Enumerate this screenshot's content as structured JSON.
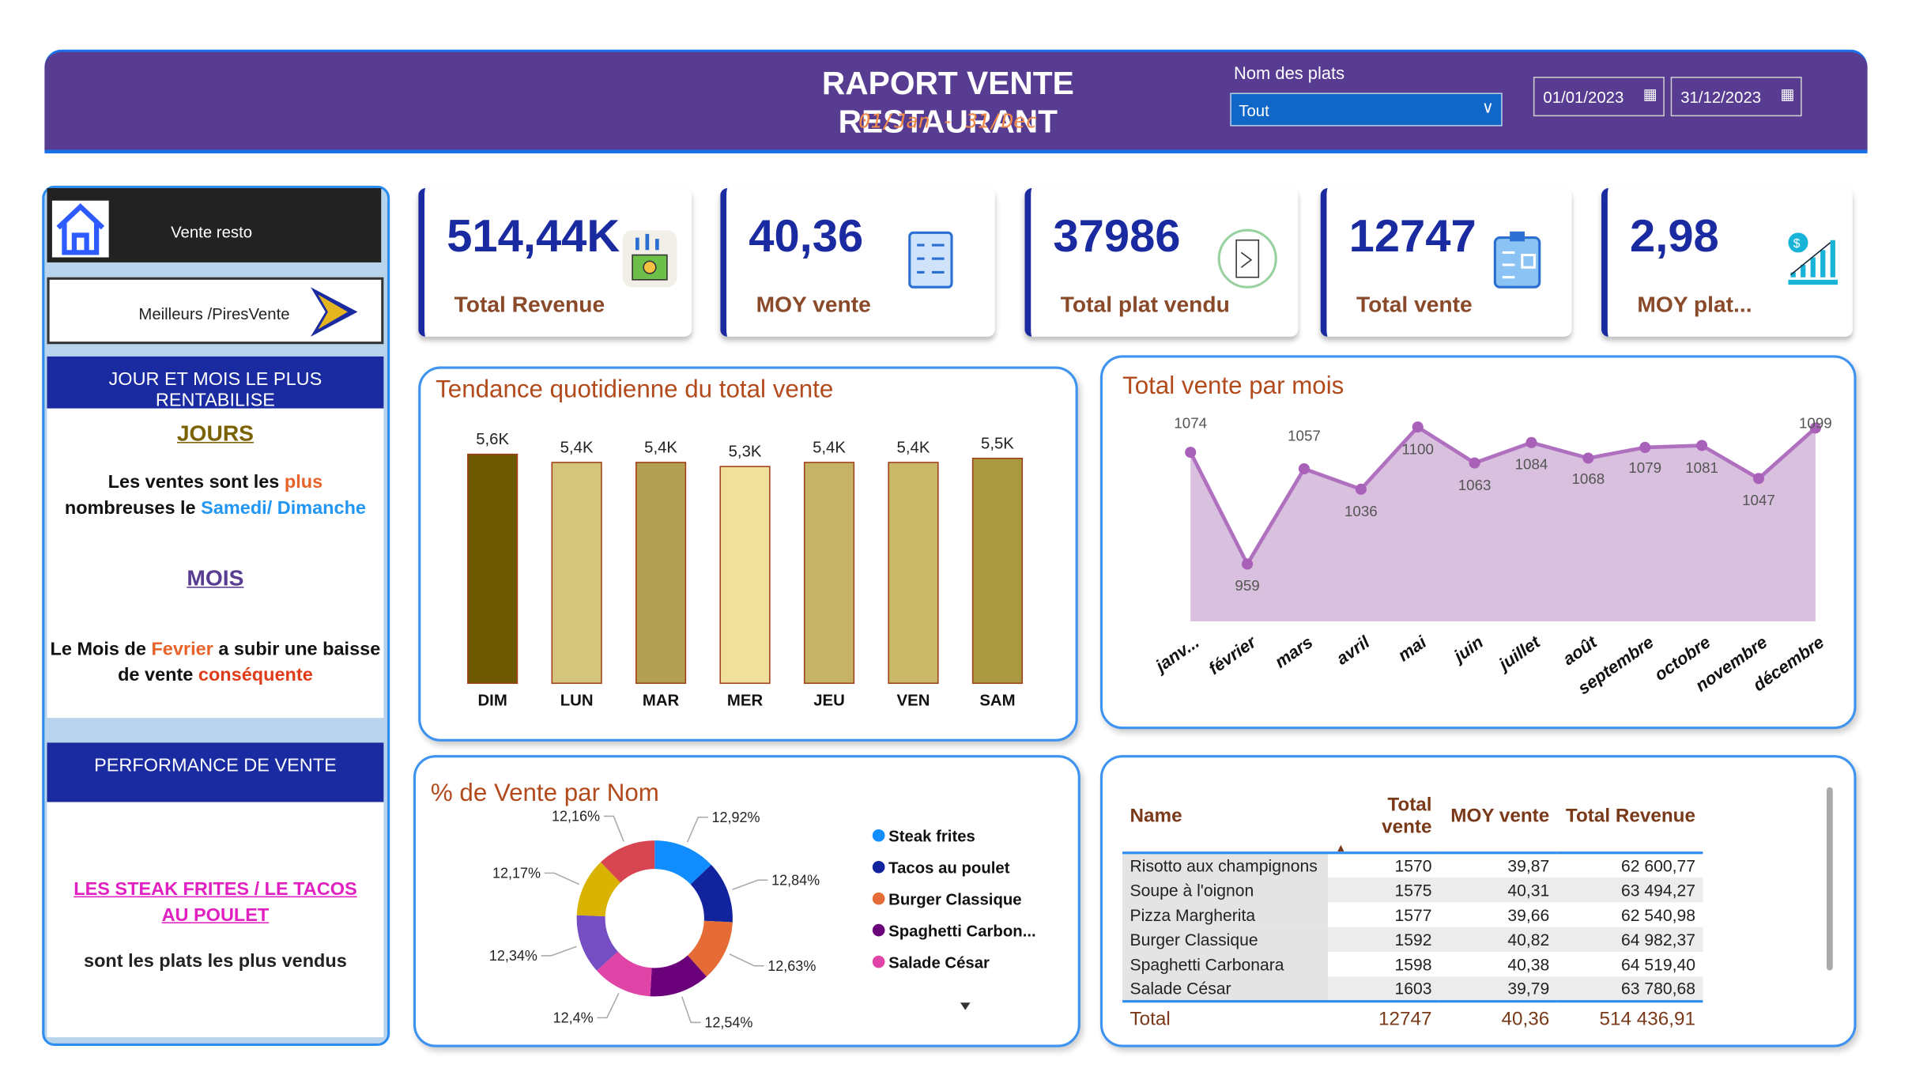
{
  "header": {
    "title": "RAPORT VENTE RESTAURANT",
    "subtitle": "01/Jan - 31/Dec",
    "slicer_label": "Nom des plats",
    "slicer_value": "Tout",
    "date_start": "01/01/2023",
    "date_end": "31/12/2023",
    "color": "#573c91"
  },
  "sidebar": {
    "nav_home": "Vente resto",
    "nav_best": "Meilleurs /PiresVente",
    "section1": "JOUR ET MOIS LE PLUS RENTABILISE",
    "jours_heading": "JOURS",
    "jours_text": [
      "Les ventes sont les ",
      "plus",
      " nombreuses le ",
      "Samedi/ Dimanche"
    ],
    "mois_heading": "MOIS",
    "mois_text": [
      "Le Mois de ",
      "Fevrier",
      " a subir une baisse de vente ",
      "conséquente"
    ],
    "section2": "PERFORMANCE DE VENTE",
    "perf_highlight": "LES STEAK FRITES / LE TACOS AU POULET",
    "perf_text": "sont les plats les plus vendus"
  },
  "kpis": [
    {
      "value": "514,44K",
      "label": "Total Revenue",
      "icon": "money-growth-icon"
    },
    {
      "value": "40,36",
      "label": "MOY vente",
      "icon": "checklist-icon"
    },
    {
      "value": "37986",
      "label": "Total plat vendu",
      "icon": "menu-icon"
    },
    {
      "value": "12747",
      "label": "Total vente",
      "icon": "clipboard-icon"
    },
    {
      "value": "2,98",
      "label": "MOY plat...",
      "icon": "chart-growth-icon"
    }
  ],
  "chart_data": [
    {
      "type": "bar",
      "title": "Tendance quotidienne du total vente",
      "categories": [
        "DIM",
        "LUN",
        "MAR",
        "MER",
        "JEU",
        "VEN",
        "SAM"
      ],
      "values": [
        5.6,
        5.4,
        5.4,
        5.3,
        5.4,
        5.4,
        5.5
      ],
      "data_labels": [
        "5,6K",
        "5,4K",
        "5,4K",
        "5,3K",
        "5,4K",
        "5,4K",
        "5,5K"
      ],
      "ylim": [
        0,
        5.6
      ],
      "colors": [
        "#6b5800",
        "#d4c47c",
        "#b3a052",
        "#efe19b",
        "#c5b466",
        "#c8b868",
        "#a99a42"
      ]
    },
    {
      "type": "area",
      "title": "Total vente par mois",
      "categories": [
        "janv...",
        "février",
        "mars",
        "avril",
        "mai",
        "juin",
        "juillet",
        "août",
        "septembre",
        "octobre",
        "novembre",
        "décembre"
      ],
      "values": [
        1074,
        959,
        1057,
        1036,
        1100,
        1063,
        1084,
        1068,
        1079,
        1081,
        1047,
        1099
      ],
      "ylim": [
        900,
        1100
      ],
      "color": "#b070c0"
    },
    {
      "type": "pie",
      "title": "% de Vente par Nom",
      "values": [
        12.92,
        12.84,
        12.63,
        12.54,
        12.4,
        12.34,
        12.17,
        12.16
      ],
      "data_labels": [
        "12,92%",
        "12,84%",
        "12,63%",
        "12,54%",
        "12,4%",
        "12,34%",
        "12,17%",
        "12,16%"
      ],
      "legend": [
        "Steak frites",
        "Tacos au poulet",
        "Burger Classique",
        "Spaghetti Carbon...",
        "Salade César"
      ],
      "colors": [
        "#118dff",
        "#12239e",
        "#e66c37",
        "#6b007b",
        "#e044a7",
        "#744ec2",
        "#d9b300",
        "#d64550"
      ]
    }
  ],
  "table": {
    "columns": [
      "Name",
      "Total vente",
      "MOY vente",
      "Total Revenue"
    ],
    "rows": [
      [
        "Risotto aux champignons",
        "1570",
        "39,87",
        "62 600,77"
      ],
      [
        "Soupe à l'oignon",
        "1575",
        "40,31",
        "63 494,27"
      ],
      [
        "Pizza Margherita",
        "1577",
        "39,66",
        "62 540,98"
      ],
      [
        "Burger Classique",
        "1592",
        "40,82",
        "64 982,37"
      ],
      [
        "Spaghetti Carbonara",
        "1598",
        "40,38",
        "64 519,40"
      ],
      [
        "Salade César",
        "1603",
        "39,79",
        "63 780,68"
      ]
    ],
    "total": [
      "Total",
      "12747",
      "40,36",
      "514 436,91"
    ]
  }
}
